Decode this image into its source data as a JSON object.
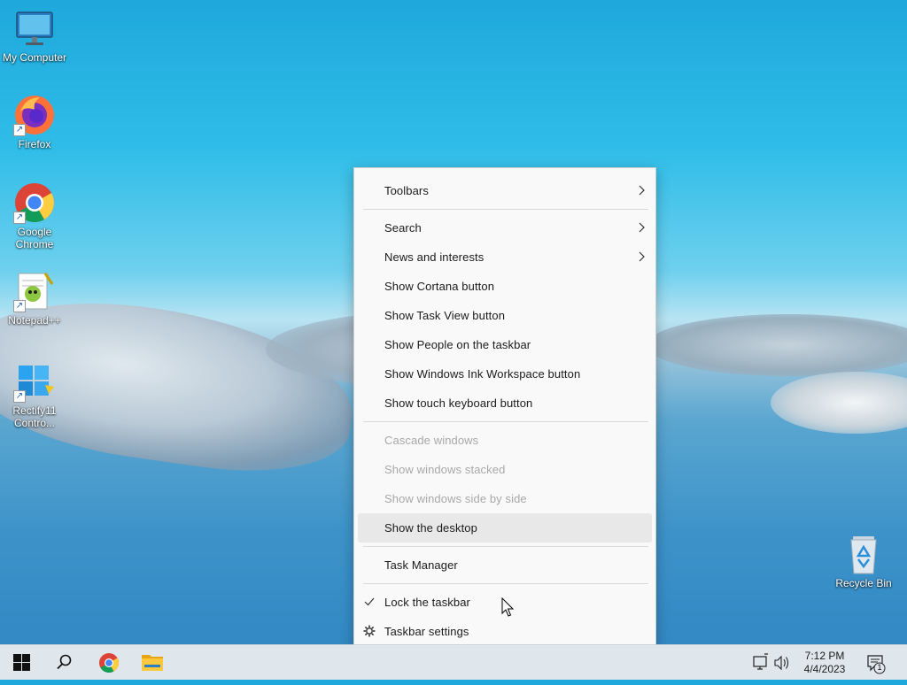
{
  "desktop": {
    "icons": [
      {
        "name": "desktop-icon-my-computer",
        "label": "My Computer"
      },
      {
        "name": "desktop-icon-firefox",
        "label": "Firefox"
      },
      {
        "name": "desktop-icon-google-chrome",
        "label": "Google Chrome"
      },
      {
        "name": "desktop-icon-notepadpp",
        "label": "Notepad++"
      },
      {
        "name": "desktop-icon-rectify11",
        "label": "Rectify11 Contro..."
      },
      {
        "name": "desktop-icon-recycle-bin",
        "label": "Recycle Bin"
      }
    ]
  },
  "context_menu": {
    "items": [
      {
        "label": "Toolbars",
        "submenu": true,
        "enabled": true
      },
      {
        "label": "Search",
        "submenu": true,
        "enabled": true
      },
      {
        "label": "News and interests",
        "submenu": true,
        "enabled": true
      },
      {
        "label": "Show Cortana button",
        "enabled": true
      },
      {
        "label": "Show Task View button",
        "enabled": true
      },
      {
        "label": "Show People on the taskbar",
        "enabled": true
      },
      {
        "label": "Show Windows Ink Workspace button",
        "enabled": true
      },
      {
        "label": "Show touch keyboard button",
        "enabled": true
      },
      {
        "label": "Cascade windows",
        "enabled": false
      },
      {
        "label": "Show windows stacked",
        "enabled": false
      },
      {
        "label": "Show windows side by side",
        "enabled": false
      },
      {
        "label": "Show the desktop",
        "enabled": true,
        "highlighted": true
      },
      {
        "label": "Task Manager",
        "enabled": true
      },
      {
        "label": "Lock the taskbar",
        "enabled": true,
        "checked": true
      },
      {
        "label": "Taskbar settings",
        "enabled": true,
        "icon": "gear-icon"
      }
    ]
  },
  "taskbar": {
    "apps": [
      "start-button",
      "search-button",
      "chrome-taskbar-button",
      "file-explorer-taskbar-button"
    ],
    "tray": {
      "time": "7:12 PM",
      "date": "4/4/2023",
      "notification_count": "1"
    }
  },
  "colors": {
    "menu_bg": "#f9f9f9",
    "menu_hover": "#e8e8e8",
    "disabled_text": "#a8a8a8",
    "taskbar_bg": "#dfe6ec"
  }
}
